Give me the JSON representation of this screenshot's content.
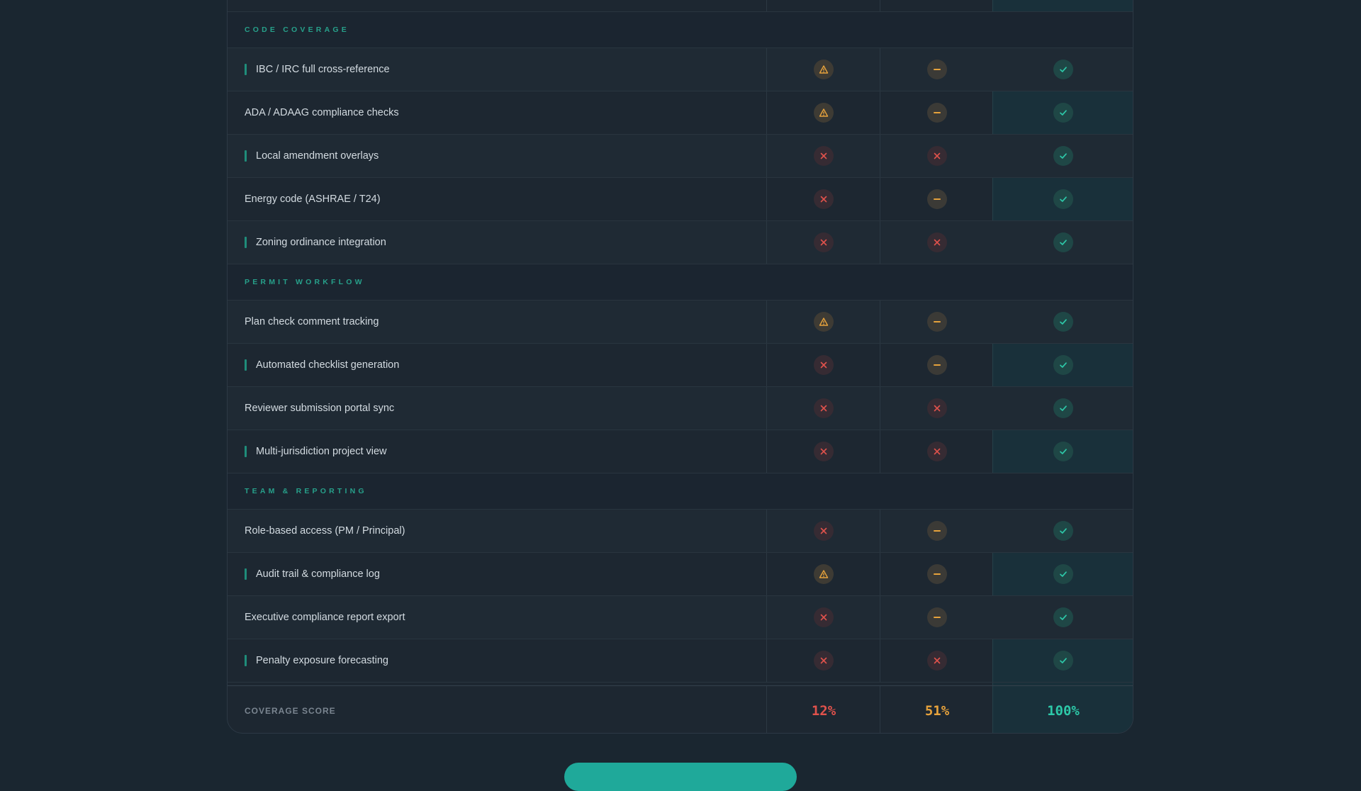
{
  "colors": {
    "background": "#1a2630",
    "accent": "#27a08a",
    "warn": "#e6a23c",
    "no": "#e0524c",
    "yes": "#2dc8a8"
  },
  "sections": [
    {
      "title": "CODE COVERAGE",
      "features": [
        {
          "label": "IBC / IRC full cross-reference",
          "accent": true,
          "status": [
            "warn",
            "partial",
            "yes"
          ]
        },
        {
          "label": "ADA / ADAAG compliance checks",
          "accent": false,
          "status": [
            "warn",
            "partial",
            "yes"
          ]
        },
        {
          "label": "Local amendment overlays",
          "accent": true,
          "status": [
            "no",
            "no",
            "yes"
          ]
        },
        {
          "label": "Energy code (ASHRAE / T24)",
          "accent": false,
          "status": [
            "no",
            "partial",
            "yes"
          ]
        },
        {
          "label": "Zoning ordinance integration",
          "accent": true,
          "status": [
            "no",
            "no",
            "yes"
          ]
        }
      ]
    },
    {
      "title": "PERMIT WORKFLOW",
      "features": [
        {
          "label": "Plan check comment tracking",
          "accent": false,
          "status": [
            "warn",
            "partial",
            "yes"
          ]
        },
        {
          "label": "Automated checklist generation",
          "accent": true,
          "status": [
            "no",
            "partial",
            "yes"
          ]
        },
        {
          "label": "Reviewer submission portal sync",
          "accent": false,
          "status": [
            "no",
            "no",
            "yes"
          ]
        },
        {
          "label": "Multi-jurisdiction project view",
          "accent": true,
          "status": [
            "no",
            "no",
            "yes"
          ]
        }
      ]
    },
    {
      "title": "TEAM & REPORTING",
      "features": [
        {
          "label": "Role-based access (PM / Principal)",
          "accent": false,
          "status": [
            "no",
            "partial",
            "yes"
          ]
        },
        {
          "label": "Audit trail & compliance log",
          "accent": true,
          "status": [
            "warn",
            "partial",
            "yes"
          ]
        },
        {
          "label": "Executive compliance report export",
          "accent": false,
          "status": [
            "no",
            "partial",
            "yes"
          ]
        },
        {
          "label": "Penalty exposure forecasting",
          "accent": true,
          "status": [
            "no",
            "no",
            "yes"
          ]
        }
      ]
    }
  ],
  "footer": {
    "label": "COVERAGE SCORE",
    "scores": [
      {
        "value": "12%",
        "color": "#e0524c"
      },
      {
        "value": "51%",
        "color": "#e6a23c"
      },
      {
        "value": "100%",
        "color": "#2dc8a8"
      }
    ]
  },
  "icons": {
    "warn": "warning-triangle-icon",
    "partial": "minus-icon",
    "no": "close-x-icon",
    "yes": "check-icon"
  }
}
